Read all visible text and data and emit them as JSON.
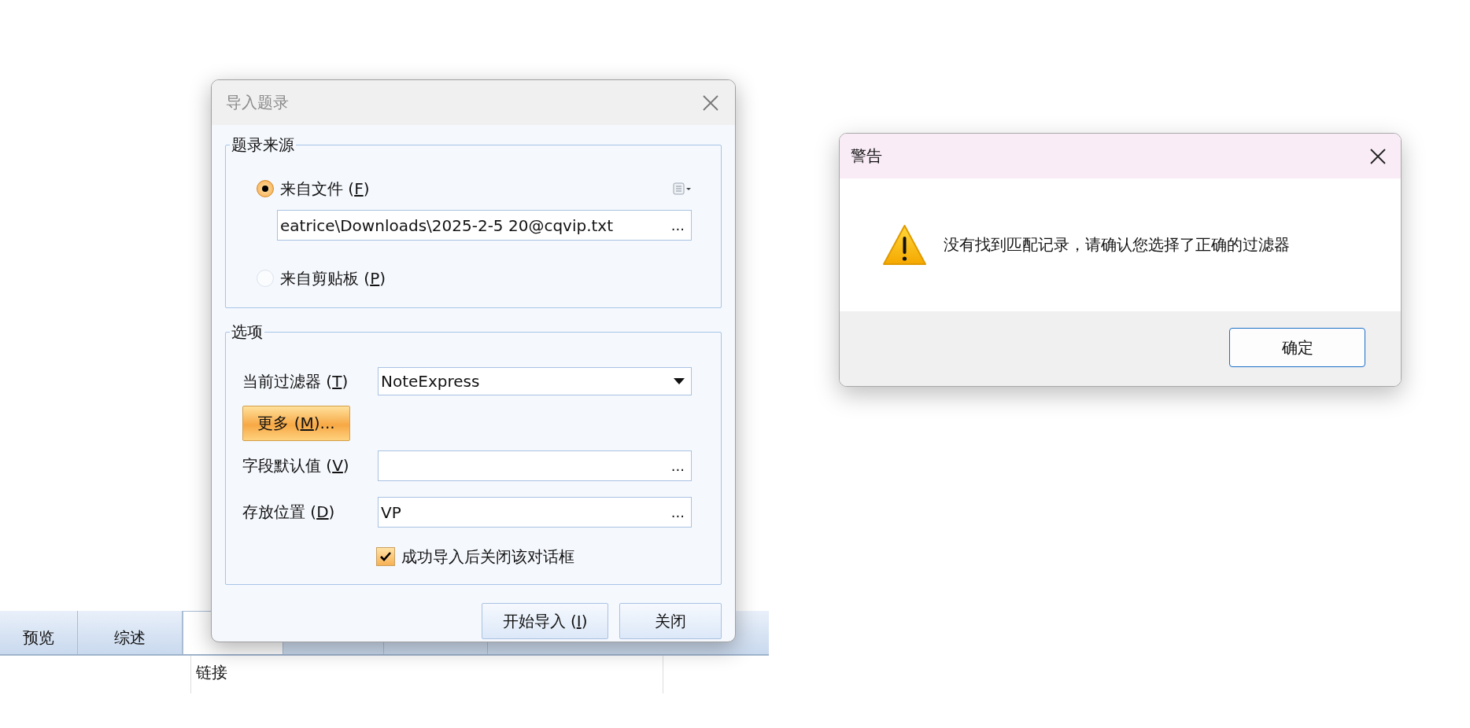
{
  "background_window": {
    "tabs": [
      {
        "label": "预览",
        "selected": false
      },
      {
        "label": "综述",
        "selected": false
      },
      {
        "selected": true
      },
      {
        "selected": false
      },
      {
        "selected": false
      }
    ],
    "list_header": "链接"
  },
  "import_dialog": {
    "title": "导入题录",
    "source_group": {
      "legend": "题录来源",
      "options": [
        {
          "before": "来自文件 (",
          "key": "F",
          "after": ")",
          "selected": true
        },
        {
          "before": "来自剪贴板 (",
          "key": "P",
          "after": ")",
          "selected": false
        }
      ],
      "file_path": {
        "value": "eatrice\\Downloads\\2025-2-5 20@cqvip.txt",
        "browse": "..."
      }
    },
    "options_group": {
      "legend": "选项",
      "filter": {
        "before": "当前过滤器 (",
        "key": "T",
        "after": ")",
        "value": "NoteExpress"
      },
      "more_button": {
        "before": "更多 (",
        "key": "M",
        "after": ")..."
      },
      "fields": [
        {
          "before": "字段默认值 (",
          "key": "V",
          "after": ")",
          "browse": "..."
        },
        {
          "before": "存放位置 (",
          "key": "D",
          "after": ")",
          "value": "VP",
          "browse": "..."
        }
      ],
      "close_after": {
        "label": "成功导入后关闭该对话框",
        "checked": true
      }
    },
    "buttons": [
      {
        "before": "开始导入 (",
        "key": "I",
        "after": ")"
      },
      {
        "before": "关闭"
      }
    ]
  },
  "warning_dialog": {
    "title": "警告",
    "message": "没有找到匹配记录，请确认您选择了正确的过滤器",
    "button": "确定"
  }
}
